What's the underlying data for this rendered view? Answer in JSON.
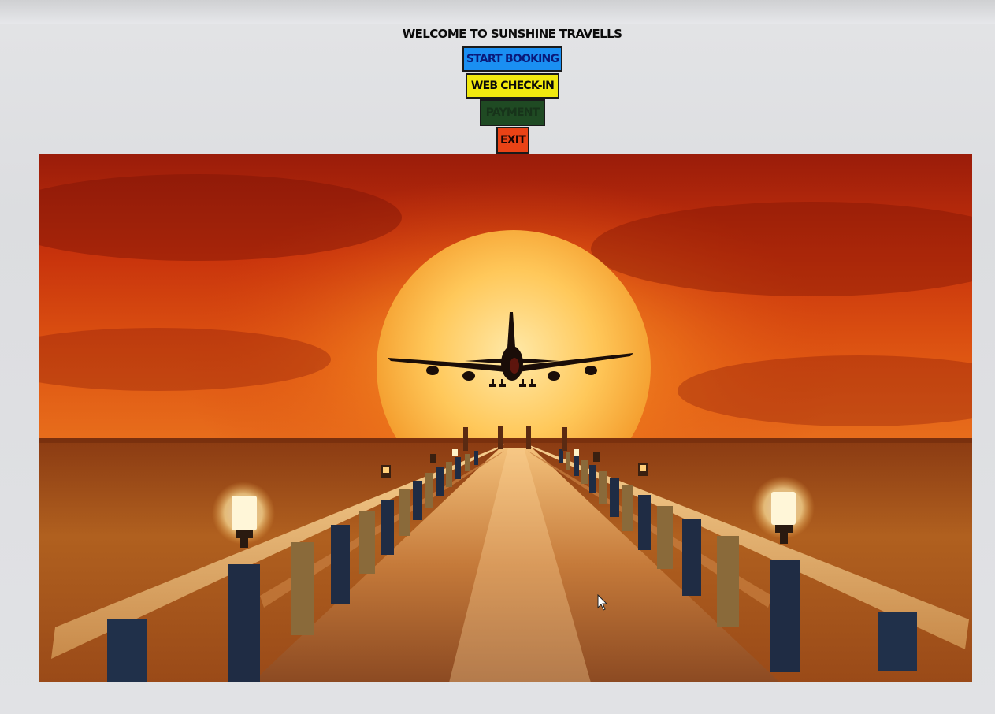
{
  "window": {
    "title": "WELCOME TO SUNSHINE TRAVELLS"
  },
  "menu": {
    "buttons": [
      {
        "label": "START BOOKING",
        "color": "#1a8ff2"
      },
      {
        "label": "WEB CHECK-IN",
        "color": "#f1e90f"
      },
      {
        "label": "PAYMENT",
        "color": "#1f4a23"
      },
      {
        "label": "EXIT",
        "color": "#ea4316"
      }
    ]
  },
  "banner": {
    "icon": "airplane-sunset-pier-image"
  },
  "colors": {
    "sky_top": "#8a1a08",
    "sky_mid": "#d9450f",
    "sun": "#ffd36a",
    "sea": "#a8561c",
    "pier": "#e7a865"
  }
}
